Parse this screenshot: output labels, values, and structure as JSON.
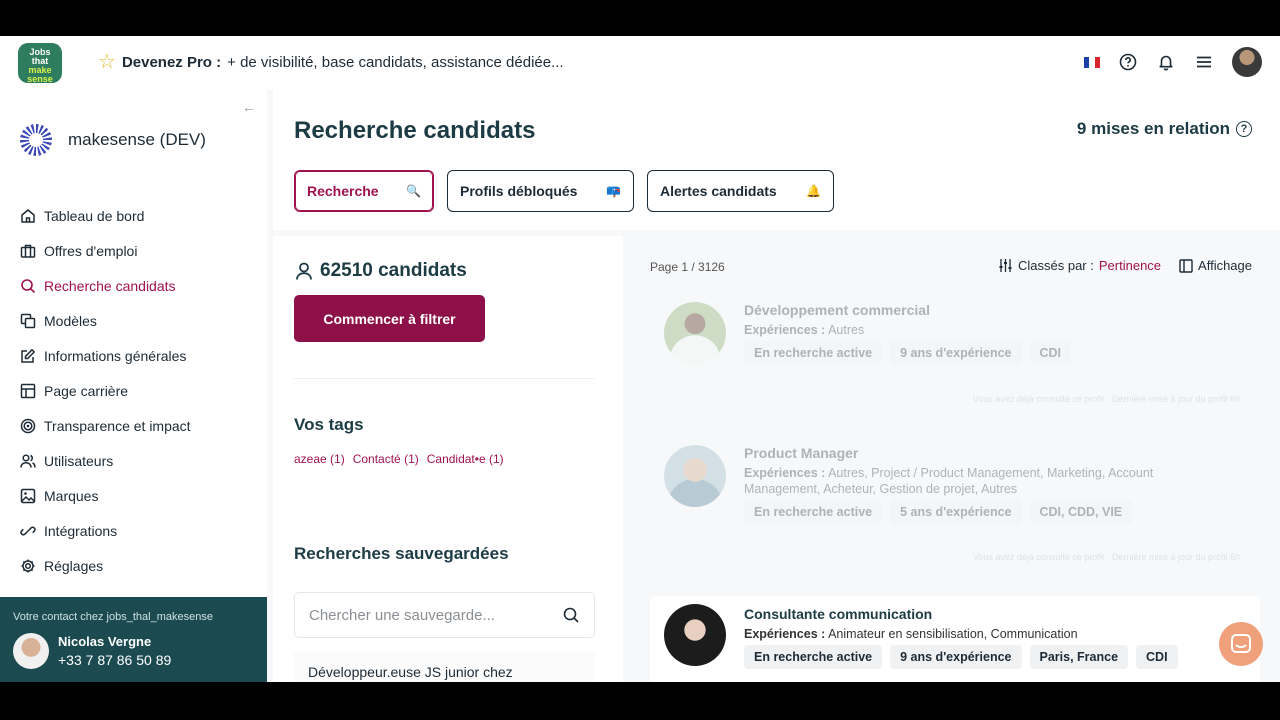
{
  "topbar": {
    "logo_lines": [
      "Jobs",
      "that",
      "make",
      "sense"
    ],
    "promo_bold": "Devenez Pro :",
    "promo_text": "+ de visibilité, base candidats, assistance dédiée...",
    "icons": [
      "fr-flag-icon",
      "help-icon",
      "bell-icon",
      "menu-icon",
      "user-avatar"
    ]
  },
  "sidebar": {
    "org_name": "makesense (DEV)",
    "items": [
      {
        "label": "Tableau de bord",
        "icon": "home-icon"
      },
      {
        "label": "Offres d'emploi",
        "icon": "briefcase-icon"
      },
      {
        "label": "Recherche candidats",
        "icon": "search-icon"
      },
      {
        "label": "Modèles",
        "icon": "copy-icon"
      },
      {
        "label": "Informations générales",
        "icon": "edit-icon"
      },
      {
        "label": "Page carrière",
        "icon": "layout-icon"
      },
      {
        "label": "Transparence et impact",
        "icon": "target-icon"
      },
      {
        "label": "Utilisateurs",
        "icon": "users-icon"
      },
      {
        "label": "Marques",
        "icon": "image-icon"
      },
      {
        "label": "Intégrations",
        "icon": "plug-icon"
      },
      {
        "label": "Réglages",
        "icon": "gear-icon"
      }
    ],
    "active_index": 2,
    "contact": {
      "label": "Votre contact chez jobs_thal_makesense",
      "name": "Nicolas Vergne",
      "phone": "+33 7 87 86 50 89"
    }
  },
  "main": {
    "title": "Recherche candidats",
    "mises": "9 mises en relation",
    "tabs": [
      {
        "label": "Recherche",
        "emoji": "🔍"
      },
      {
        "label": "Profils débloqués",
        "emoji": "📪"
      },
      {
        "label": "Alertes candidats",
        "emoji": "🔔"
      }
    ],
    "count": "62510 candidats",
    "filter_button": "Commencer à filtrer",
    "tags_title": "Vos tags",
    "tags": [
      "azeae (1)",
      "Contacté (1)",
      "Candidat•e (1)"
    ],
    "saved_title": "Recherches sauvegardées",
    "saved_search_placeholder": "Chercher une sauvegarde...",
    "saved_item": "Développeur.euse JS junior chez",
    "page_info": "Page 1 / 3126",
    "sort_label": "Classés par :",
    "sort_value": "Pertinence",
    "display_label": "Affichage",
    "exp_label": "Expériences :"
  },
  "candidates": [
    {
      "title": "Développement commercial",
      "experiences": "Autres",
      "tags": [
        "En recherche active",
        "9 ans d'expérience",
        "CDI"
      ],
      "note": "Vous avez déjà consulté ce profil · Dernière mise à jour du profil 6h"
    },
    {
      "title": "Product Manager",
      "experiences": "Autres, Project / Product Management, Marketing, Account Management, Acheteur, Gestion de projet, Autres",
      "tags": [
        "En recherche active",
        "5 ans d'expérience",
        "CDI, CDD, VIE"
      ],
      "note": "Vous avez déjà consulté ce profil · Dernière mise à jour du profil 6h"
    },
    {
      "title": "Consultante communication",
      "experiences": "Animateur en sensibilisation, Communication",
      "tags": [
        "En recherche active",
        "9 ans d'expérience",
        "Paris, France",
        "CDI"
      ]
    }
  ],
  "colors": {
    "accent": "#a0124f",
    "primary_button": "#8d1048",
    "contact_bg": "#1b4b51",
    "chat_bubble": "#f0a07a"
  }
}
